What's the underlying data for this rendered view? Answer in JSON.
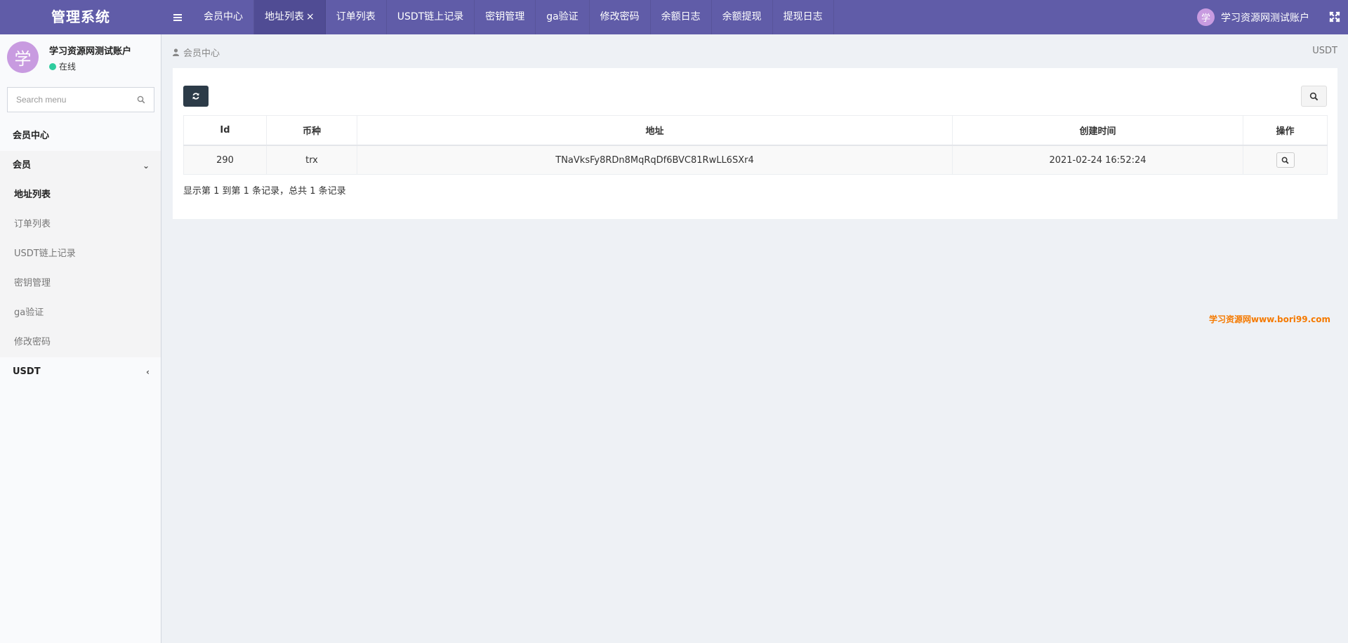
{
  "app": {
    "title": "管理系统"
  },
  "topnav": {
    "tabs": [
      {
        "label": "会员中心"
      },
      {
        "label": "地址列表",
        "close": "×"
      },
      {
        "label": "订单列表"
      },
      {
        "label": "USDT链上记录"
      },
      {
        "label": "密钥管理"
      },
      {
        "label": "ga验证"
      },
      {
        "label": "修改密码"
      },
      {
        "label": "余额日志"
      },
      {
        "label": "余额提现"
      },
      {
        "label": "提现日志"
      }
    ],
    "user": {
      "avatar_char": "学",
      "name": "学习资源网测试账户"
    }
  },
  "sidebar": {
    "user": {
      "avatar_char": "学",
      "name": "学习资源网测试账户",
      "status": "在线"
    },
    "search": {
      "placeholder": "Search menu"
    },
    "menu": {
      "home": "会员中心",
      "group": "会员",
      "group_chevron": "⌄",
      "items": [
        {
          "label": "地址列表"
        },
        {
          "label": "订单列表"
        },
        {
          "label": "USDT链上记录"
        },
        {
          "label": "密钥管理"
        },
        {
          "label": "ga验证"
        },
        {
          "label": "修改密码"
        }
      ],
      "usdt": "USDT",
      "usdt_chevron": "‹"
    }
  },
  "breadcrumb": {
    "current": "会员中心",
    "right": "USDT"
  },
  "table": {
    "headers": [
      "Id",
      "币种",
      "地址",
      "创建时间",
      "操作"
    ],
    "rows": [
      {
        "id": "290",
        "coin": "trx",
        "address": "TNaVksFy8RDn8MqRqDf6BVC81RwLL6SXr4",
        "created": "2021-02-24 16:52:24"
      }
    ]
  },
  "pagination": {
    "info": "显示第 1 到第 1 条记录，总共 1 条记录"
  },
  "watermark": "学习资源网www.bori99.com",
  "colors": {
    "topbar": "#605ca8",
    "active_tab": "#504c94",
    "avatar": "#c89be0",
    "online": "#2ecc9e",
    "refresh_button": "#2c3b48",
    "watermark": "#f57a00"
  }
}
